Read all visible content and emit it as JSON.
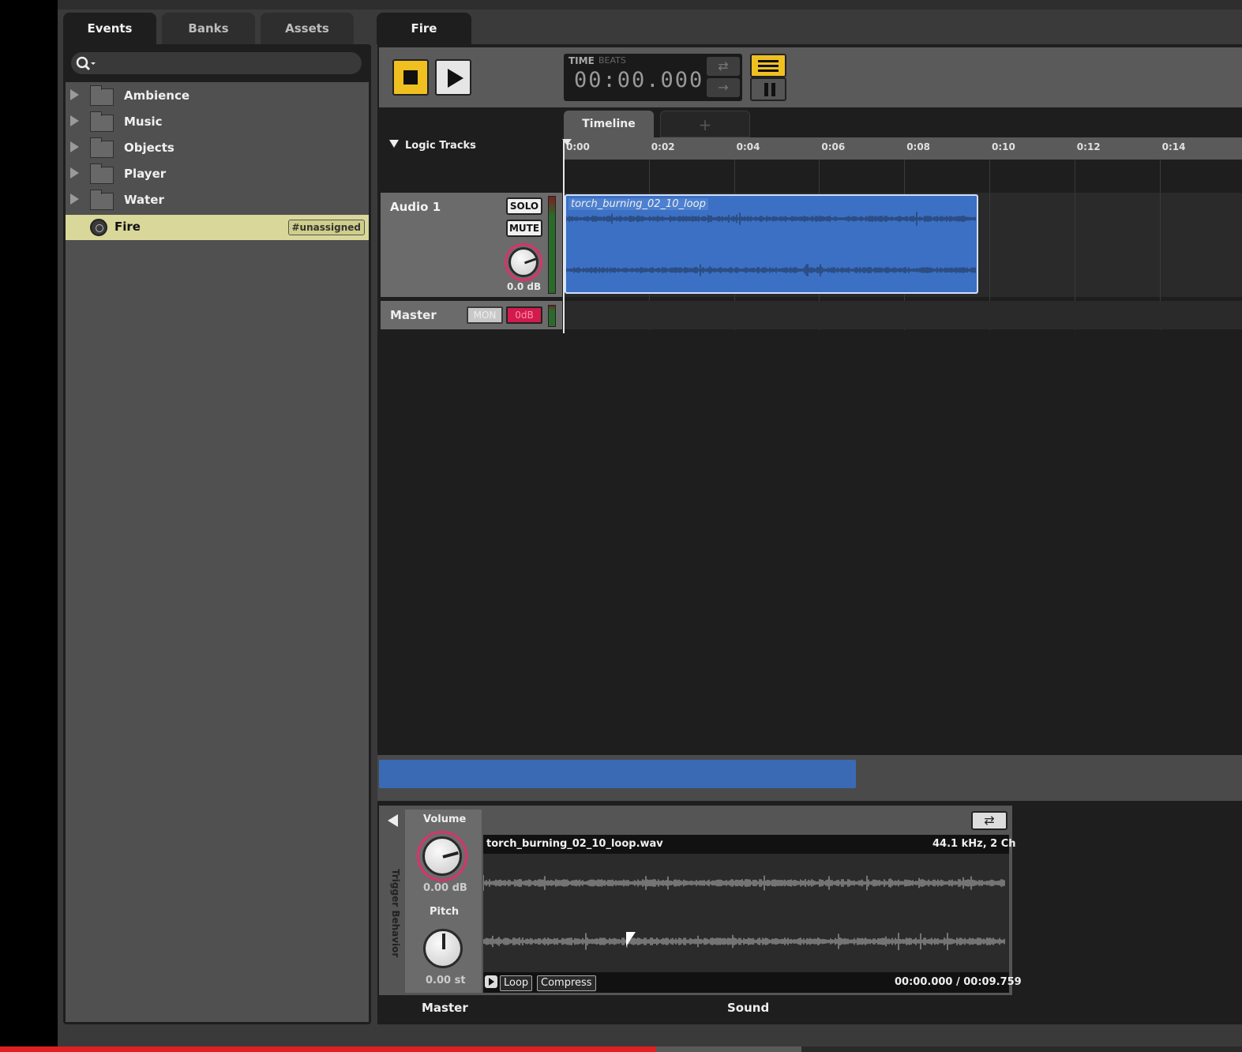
{
  "browser": {
    "tabs": [
      {
        "label": "Events",
        "active": true
      },
      {
        "label": "Banks",
        "active": false
      },
      {
        "label": "Assets",
        "active": false
      }
    ],
    "tree": [
      {
        "label": "Ambience",
        "type": "folder"
      },
      {
        "label": "Music",
        "type": "folder"
      },
      {
        "label": "Objects",
        "type": "folder"
      },
      {
        "label": "Player",
        "type": "folder"
      },
      {
        "label": "Water",
        "type": "folder"
      },
      {
        "label": "Fire",
        "type": "event",
        "selected": true,
        "badge": "#unassigned"
      }
    ]
  },
  "editor": {
    "tab": "Fire",
    "transport": {
      "time_label": "TIME",
      "beats_label": "BEATS",
      "time_value": "00:00.000",
      "accent": "#f0c020"
    },
    "timeline_tab": "Timeline",
    "add_tab": "+",
    "logic_tracks": "Logic Tracks",
    "ruler_ticks": [
      "0:00",
      "0:02",
      "0:04",
      "0:06",
      "0:08",
      "0:10",
      "0:12",
      "0:14"
    ],
    "tracks": {
      "audio1": {
        "name": "Audio 1",
        "solo": "SOLO",
        "mute": "MUTE",
        "volume": "0.0 dB",
        "clip": "torch_burning_02_10_loop",
        "clip_color": "#3b70c4"
      },
      "master": {
        "name": "Master",
        "mon": "MON",
        "odb": "0dB"
      }
    }
  },
  "deck": {
    "trigger_behavior": "Trigger Behavior",
    "volume_label": "Volume",
    "volume_value": "0.00 dB",
    "pitch_label": "Pitch",
    "pitch_value": "0.00 st",
    "sound": {
      "file": "torch_burning_02_10_loop.wav",
      "format": "44.1 kHz, 2 Ch",
      "loop": "Loop",
      "compress": "Compress",
      "time": "00:00.000 / 00:09.759"
    },
    "tabs": [
      "Master",
      "Sound"
    ]
  },
  "video_progress": {
    "played_fraction": 0.528,
    "buffered_fraction": 0.645
  }
}
